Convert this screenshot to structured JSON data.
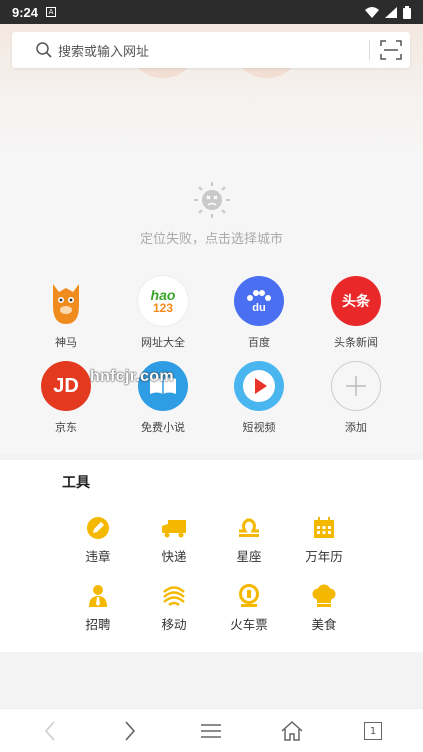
{
  "status": {
    "time": "9:24",
    "notif": "A"
  },
  "search": {
    "placeholder": "搜索或输入网址"
  },
  "weather": {
    "message": "定位失败，点击选择城市"
  },
  "shortcuts": [
    {
      "label": "神马",
      "icon": "alpaca-icon",
      "color": "#f08c1e"
    },
    {
      "label": "网址大全",
      "icon": "hao123-icon",
      "color": "#ffffff",
      "logo_top": "hao",
      "logo_bottom": "123"
    },
    {
      "label": "百度",
      "icon": "baidu-paw-icon",
      "color": "#4a6ff0",
      "logo": "du"
    },
    {
      "label": "头条新闻",
      "icon": "toutiao-icon",
      "color": "#e9282a",
      "logo": "头条"
    },
    {
      "label": "京东",
      "icon": "jd-icon",
      "color": "#e3391f",
      "logo": "JD"
    },
    {
      "label": "免费小说",
      "icon": "book-icon",
      "color": "#2f9de4"
    },
    {
      "label": "短视频",
      "icon": "play-icon",
      "color": "#4ab6f0"
    },
    {
      "label": "添加",
      "icon": "plus-icon",
      "color": "#cccccc"
    }
  ],
  "watermark": "hnfcjr.com",
  "tools": {
    "title": "工具",
    "accent": "#f5b800",
    "items": [
      {
        "label": "违章",
        "icon": "pen-icon"
      },
      {
        "label": "快递",
        "icon": "truck-icon"
      },
      {
        "label": "星座",
        "icon": "libra-icon"
      },
      {
        "label": "万年历",
        "icon": "calendar-icon"
      },
      {
        "label": "招聘",
        "icon": "person-icon"
      },
      {
        "label": "移动",
        "icon": "china-mobile-icon"
      },
      {
        "label": "火车票",
        "icon": "train-icon"
      },
      {
        "label": "美食",
        "icon": "chef-hat-icon"
      }
    ]
  },
  "nav": {
    "page_count": "1"
  }
}
